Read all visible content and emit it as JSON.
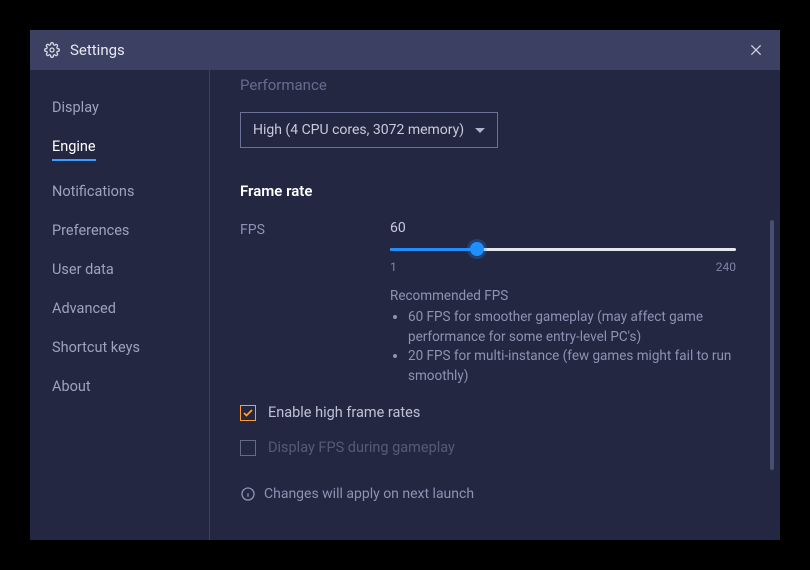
{
  "title": "Settings",
  "sidebar": {
    "items": [
      {
        "label": "Display"
      },
      {
        "label": "Engine"
      },
      {
        "label": "Notifications"
      },
      {
        "label": "Preferences"
      },
      {
        "label": "User data"
      },
      {
        "label": "Advanced"
      },
      {
        "label": "Shortcut keys"
      },
      {
        "label": "About"
      }
    ],
    "active_index": 1
  },
  "performance": {
    "heading": "Performance",
    "dropdown_value": "High (4 CPU cores, 3072 memory)"
  },
  "frame_rate": {
    "heading": "Frame rate",
    "fps_label": "FPS",
    "fps_value": "60",
    "slider_min": "1",
    "slider_max": "240",
    "recommended_title": "Recommended FPS",
    "recommendations": [
      "60 FPS for smoother gameplay (may affect game performance for some entry-level PC's)",
      "20 FPS for multi-instance (few games might fail to run smoothly)"
    ],
    "enable_high_label": "Enable high frame rates",
    "enable_high_checked": true,
    "display_fps_label": "Display FPS during gameplay",
    "display_fps_checked": false
  },
  "footer_notice": "Changes will apply on next launch"
}
